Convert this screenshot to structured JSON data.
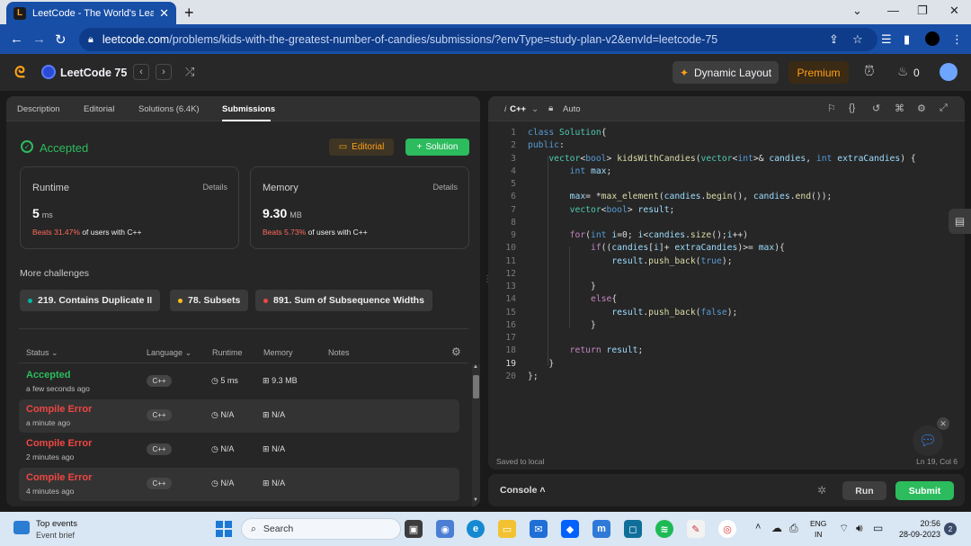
{
  "browser": {
    "tab_title": "LeetCode - The World's Leading",
    "url_host": "leetcode.com",
    "url_path": "/problems/kids-with-the-greatest-number-of-candies/submissions/?envType=study-plan-v2&envId=leetcode-75"
  },
  "header": {
    "title": "LeetCode 75",
    "dynamic_layout": "Dynamic Layout",
    "premium": "Premium",
    "streak": "0"
  },
  "left": {
    "tabs": [
      "Description",
      "Editorial",
      "Solutions (6.4K)",
      "Submissions"
    ],
    "status": "Accepted",
    "editorial_btn": "Editorial",
    "solution_btn": "Solution",
    "runtime": {
      "title": "Runtime",
      "details": "Details",
      "value": "5",
      "unit": "ms",
      "beats_pct": "Beats 31.47%",
      "beats_text": "of users with C++"
    },
    "memory": {
      "title": "Memory",
      "details": "Details",
      "value": "9.30",
      "unit": "MB",
      "beats_pct": "Beats 5.73%",
      "beats_text": "of users with C++"
    },
    "more_title": "More challenges",
    "challenges": [
      {
        "label": "219. Contains Duplicate II",
        "color": "#00b8a3"
      },
      {
        "label": "78. Subsets",
        "color": "#ffc01e"
      },
      {
        "label": "891. Sum of Subsequence Widths",
        "color": "#ef4743"
      }
    ],
    "table_headers": {
      "status": "Status",
      "language": "Language",
      "runtime": "Runtime",
      "memory": "Memory",
      "notes": "Notes"
    },
    "rows": [
      {
        "status": "Accepted",
        "time": "a few seconds ago",
        "lang": "C++",
        "runtime": "5 ms",
        "memory": "9.3 MB"
      },
      {
        "status": "Compile Error",
        "time": "a minute ago",
        "lang": "C++",
        "runtime": "N/A",
        "memory": "N/A"
      },
      {
        "status": "Compile Error",
        "time": "2 minutes ago",
        "lang": "C++",
        "runtime": "N/A",
        "memory": "N/A"
      },
      {
        "status": "Compile Error",
        "time": "4 minutes ago",
        "lang": "C++",
        "runtime": "N/A",
        "memory": "N/A"
      }
    ]
  },
  "editor": {
    "language": "C++",
    "mode": "Auto",
    "saved": "Saved to local",
    "cursor": "Ln 19, Col 6",
    "current_line": 19,
    "code_html": [
      "<span class=\"k\">class</span> <span class=\"t\">Solution</span>{",
      "<span class=\"k\">public</span>:",
      "    <span class=\"t\">vector</span>&lt;<span class=\"k\">bool</span>&gt; <span class=\"f\">kidsWithCandies</span>(<span class=\"t\">vector</span>&lt;<span class=\"k\">int</span>&gt;&amp; <span class=\"v\">candies</span>, <span class=\"k\">int</span> <span class=\"v\">extraCandies</span>) {",
      "        <span class=\"k\">int</span> <span class=\"v\">max</span>;",
      "",
      "        <span class=\"v\">max</span>= *<span class=\"f\">max_element</span>(<span class=\"v\">candies</span>.<span class=\"f\">begin</span>(), <span class=\"v\">candies</span>.<span class=\"f\">end</span>());",
      "        <span class=\"t\">vector</span>&lt;<span class=\"k\">bool</span>&gt; <span class=\"v\">result</span>;",
      "",
      "        <span class=\"c\">for</span>(<span class=\"k\">int</span> <span class=\"v\">i</span>=0; <span class=\"v\">i</span>&lt;<span class=\"v\">candies</span>.<span class=\"f\">size</span>();<span class=\"v\">i</span>++)",
      "            <span class=\"c\">if</span>((<span class=\"v\">candies</span>[<span class=\"v\">i</span>]+ <span class=\"v\">extraCandies</span>)&gt;= <span class=\"v\">max</span>){",
      "                <span class=\"v\">result</span>.<span class=\"f\">push_back</span>(<span class=\"k\">true</span>);",
      "",
      "            }",
      "            <span class=\"c\">else</span>{",
      "                <span class=\"v\">result</span>.<span class=\"f\">push_back</span>(<span class=\"k\">false</span>);",
      "            }",
      "",
      "        <span class=\"c\">return</span> <span class=\"v\">result</span>;",
      "    }",
      "};"
    ]
  },
  "console": {
    "label": "Console",
    "run": "Run",
    "submit": "Submit"
  },
  "taskbar": {
    "events_title": "Top events",
    "events_sub": "Event brief",
    "search": "Search",
    "lang1": "ENG",
    "lang2": "IN",
    "time": "20:56",
    "date": "28-09-2023",
    "notif": "2"
  }
}
